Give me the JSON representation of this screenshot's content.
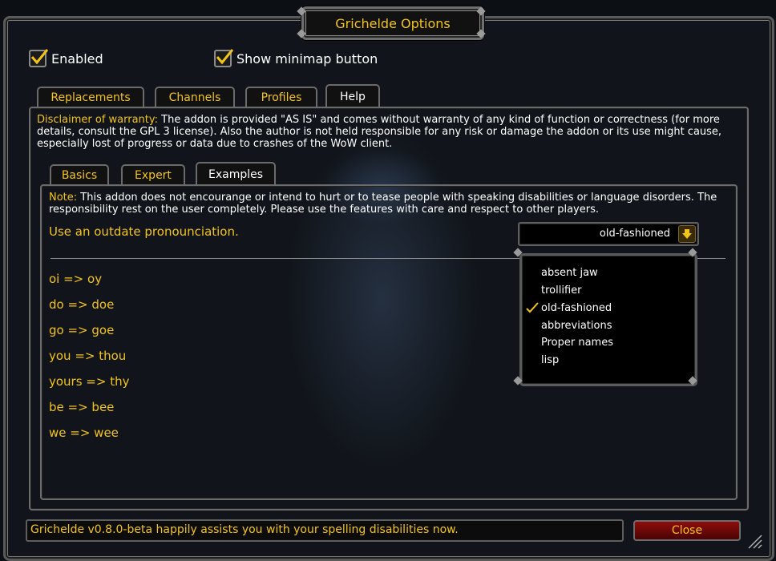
{
  "window": {
    "title": "Grichelde Options",
    "enabled_label": "Enabled",
    "minimap_label": "Show minimap button"
  },
  "top_tabs": [
    {
      "label": "Replacements"
    },
    {
      "label": "Channels"
    },
    {
      "label": "Profiles"
    },
    {
      "label": "Help",
      "active": true
    }
  ],
  "disclaimer": {
    "heading": "Disclaimer of warranty:",
    "text": " The addon is provided \"AS IS\" and comes without warranty of any kind of function or correctness (for more details, consult the GPL 3 license). Also the author is not held responsible for any risk or damage the addon or its use might cause, especially lost of progress or data due to crashes of the WoW client."
  },
  "sub_tabs": [
    {
      "label": "Basics"
    },
    {
      "label": "Expert"
    },
    {
      "label": "Examples",
      "active": true
    }
  ],
  "note": {
    "heading": "Note:",
    "text": " This addon does not encourange or intend to hurt or to tease people with speaking disabilities or language disorders. The responsibility rest on the user completely. Please use the features with care and respect to other players."
  },
  "example_setting": {
    "label": "Use an outdate pronounciation.",
    "selected": "old-fashioned"
  },
  "dropdown_menu": {
    "items": [
      "absent jaw",
      "trollifier",
      "old-fashioned",
      "abbreviations",
      "Proper names",
      "lisp"
    ],
    "checked_index": 2
  },
  "examples": [
    "oi => oy",
    "do => doe",
    "go => goe",
    "you => thou",
    "yours => thy",
    "be => bee",
    "we => wee"
  ],
  "status": "Grichelde v0.8.0-beta happily assists you with your spelling disabilities now.",
  "close_label": "Close",
  "colors": {
    "accent": "#f2c419",
    "close_button": "#8e0d0d"
  }
}
